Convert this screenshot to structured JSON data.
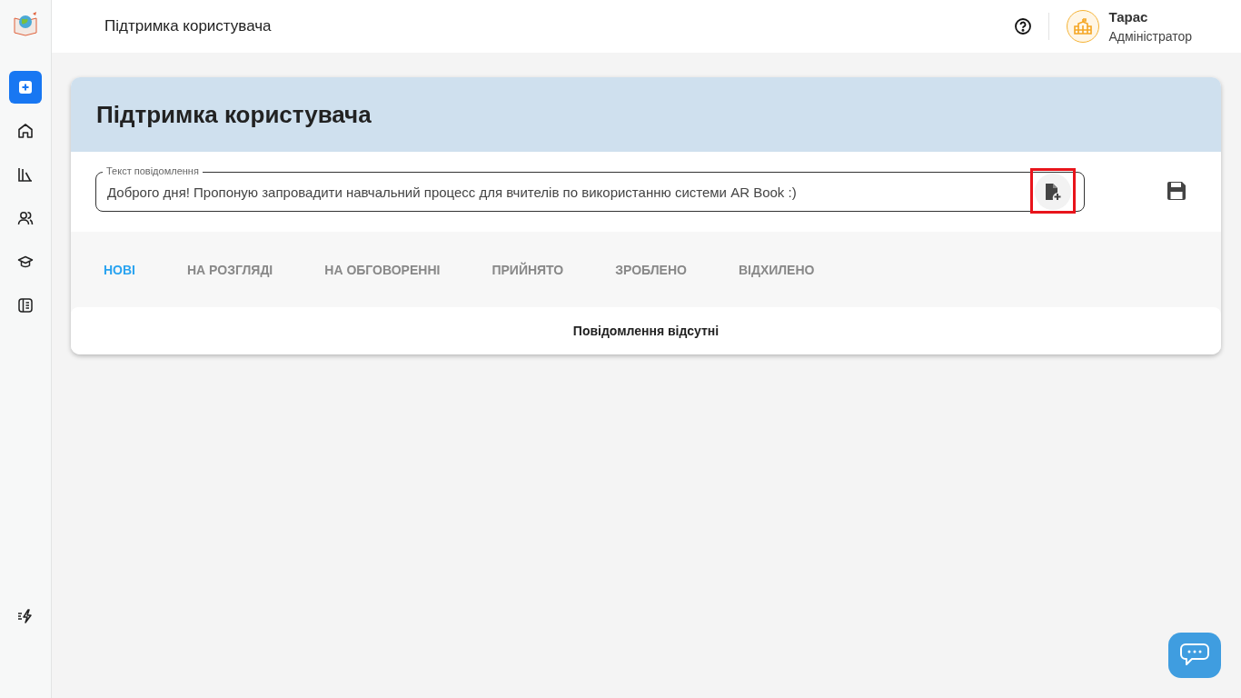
{
  "sidebar": {
    "items": [
      {
        "selected": true
      },
      {
        "selected": false
      },
      {
        "selected": false
      },
      {
        "selected": false
      },
      {
        "selected": false
      },
      {
        "selected": false
      }
    ]
  },
  "header": {
    "title": "Підтримка користувача",
    "user": {
      "name": "Тарас",
      "role": "Адміністратор"
    }
  },
  "card": {
    "title": "Підтримка користувача",
    "message_field": {
      "label": "Текст повідомлення",
      "value": "Доброго дня! Пропоную запровадити навчальний процесс для вчителів по використанню системи AR Book :)",
      "attach_highlighted": true
    },
    "tabs": [
      {
        "label": "НОВІ",
        "selected": true
      },
      {
        "label": "НА РОЗГЛЯДІ",
        "selected": false
      },
      {
        "label": "НА ОБГОВОРЕННІ",
        "selected": false
      },
      {
        "label": "ПРИЙНЯТО",
        "selected": false
      },
      {
        "label": "ЗРОБЛЕНО",
        "selected": false
      },
      {
        "label": "ВІДХИЛЕНО",
        "selected": false
      }
    ],
    "empty_text": "Повідомлення відсутні"
  }
}
